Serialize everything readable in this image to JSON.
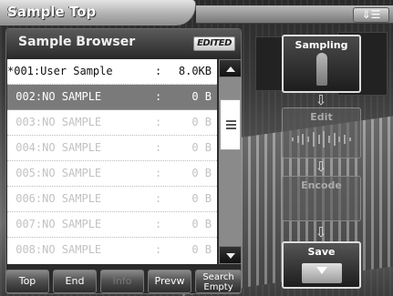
{
  "window": {
    "title": "Sample Top",
    "menu_icon": "menu-list-icon"
  },
  "browser": {
    "title": "Sample Browser",
    "badge": "EDITED",
    "rows": [
      {
        "name": "*001:User Sample",
        "colon": ":",
        "size": "8.0KB",
        "state": "first"
      },
      {
        "name": " 002:NO SAMPLE",
        "colon": ":",
        "size": "0 B",
        "state": "selected"
      },
      {
        "name": " 003:NO SAMPLE",
        "colon": ":",
        "size": "0 B",
        "state": "empty"
      },
      {
        "name": " 004:NO SAMPLE",
        "colon": ":",
        "size": "0 B",
        "state": "empty"
      },
      {
        "name": " 005:NO SAMPLE",
        "colon": ":",
        "size": "0 B",
        "state": "empty"
      },
      {
        "name": " 006:NO SAMPLE",
        "colon": ":",
        "size": "0 B",
        "state": "empty"
      },
      {
        "name": " 007:NO SAMPLE",
        "colon": ":",
        "size": "0 B",
        "state": "empty"
      },
      {
        "name": " 008:NO SAMPLE",
        "colon": ":",
        "size": "0 B",
        "state": "empty"
      }
    ]
  },
  "buttons": {
    "top": "Top",
    "end": "End",
    "info": "Info",
    "preview": "Prevw",
    "search_line1": "Search",
    "search_line2": "Empty"
  },
  "workflow": {
    "sampling": "Sampling",
    "edit": "Edit",
    "encode": "Encode",
    "save": "Save"
  }
}
